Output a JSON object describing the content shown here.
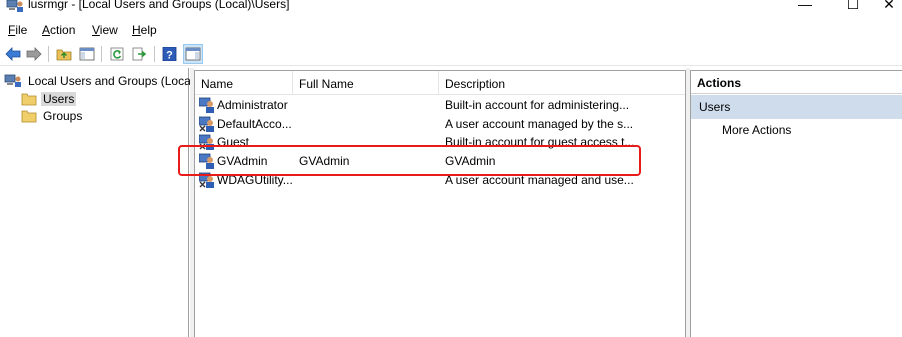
{
  "window": {
    "title": "lusrmgr - [Local Users and Groups (Local)\\Users]",
    "min_glyph": "—",
    "max_glyph": "☐",
    "close_glyph": "✕"
  },
  "menu": {
    "file": {
      "accel": "F",
      "rest": "ile"
    },
    "action": {
      "accel": "A",
      "rest": "ction"
    },
    "view": {
      "accel": "V",
      "rest": "iew"
    },
    "help": {
      "accel": "H",
      "rest": "elp"
    }
  },
  "toolbar": {
    "icons": [
      "back-arrow-icon",
      "forward-arrow-icon",
      "up-folder-icon",
      "show-hide-tree-icon",
      "refresh-icon",
      "export-list-icon",
      "help-icon",
      "show-hide-action-pane-icon"
    ]
  },
  "tree": {
    "root": "Local Users and Groups (Local)",
    "users": "Users",
    "groups": "Groups"
  },
  "list": {
    "columns": {
      "name": "Name",
      "full_name": "Full Name",
      "description": "Description"
    },
    "rows": [
      {
        "name": "Administrator",
        "full_name": "",
        "description": "Built-in account for administering..."
      },
      {
        "name": "DefaultAcco...",
        "full_name": "",
        "description": "A user account managed by the s..."
      },
      {
        "name": "Guest",
        "full_name": "",
        "description": "Built-in account for guest access t..."
      },
      {
        "name": "GVAdmin",
        "full_name": "GVAdmin",
        "description": "GVAdmin"
      },
      {
        "name": "WDAGUtility...",
        "full_name": "",
        "description": "A user account managed and use..."
      }
    ]
  },
  "actions": {
    "header": "Actions",
    "section": "Users",
    "more": "More Actions"
  },
  "colors": {
    "highlight_box": "#e81a1a",
    "actions_section_bg": "#cfdcec",
    "selected_tree_bg": "#d9d9d9"
  }
}
